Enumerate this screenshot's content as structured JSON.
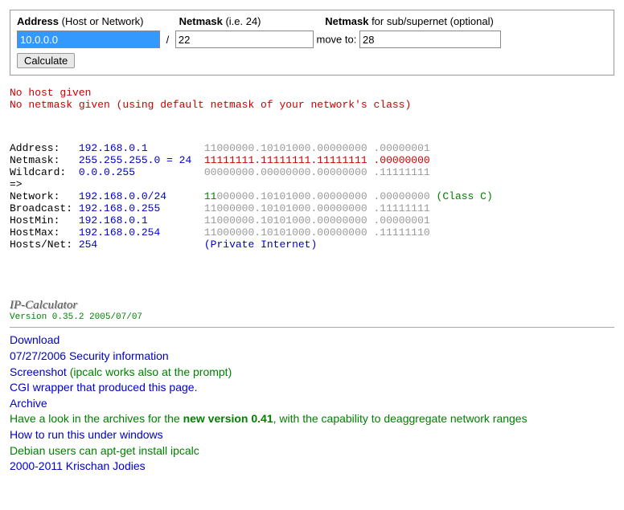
{
  "form": {
    "address_label_bold": "Address",
    "address_label_hint": " (Host or Network)",
    "netmask_label_bold": "Netmask",
    "netmask_label_hint": " (i.e. 24)",
    "netmask2_label_bold": "Netmask",
    "netmask2_label_hint": " for sub/supernet (optional)",
    "move_to_label": "move to: ",
    "address_value": "10.0.0.0",
    "mask_value": "22",
    "move_value": "28",
    "slash": "/",
    "calculate_label": "Calculate"
  },
  "warnings": "No host given\nNo netmask given (using default netmask of your network's class)",
  "rows": {
    "address": {
      "lbl": "Address:   ",
      "val": "192.168.0.1         ",
      "bin_g": "11000000.10101000.00000000 .",
      "bin_c": "00000001",
      "color": "grey"
    },
    "netmask": {
      "lbl": "Netmask:   ",
      "val": "255.255.255.0 = 24  ",
      "bin_r": "11111111.11111111.11111111 .",
      "bin_c": "00000000",
      "color": "red"
    },
    "wildcard": {
      "lbl": "Wildcard:  ",
      "val": "0.0.0.255           ",
      "bin_g": "00000000.00000000.00000000 .",
      "bin_c": "11111111",
      "color": "grey"
    },
    "arrow": "=>",
    "network": {
      "lbl": "Network:   ",
      "val": "192.168.0.0/24      ",
      "bin_b": "11",
      "bin_g": "000000.10101000.00000000 .",
      "bin_c": "00000000",
      "suffix": " (Class C)"
    },
    "broadcast": {
      "lbl": "Broadcast: ",
      "val": "192.168.0.255       ",
      "bin_g": "11000000.10101000.00000000 .",
      "bin_c": "11111111",
      "color": "grey"
    },
    "hostmin": {
      "lbl": "HostMin:   ",
      "val": "192.168.0.1         ",
      "bin_g": "11000000.10101000.00000000 .",
      "bin_c": "00000001",
      "color": "grey"
    },
    "hostmax": {
      "lbl": "HostMax:   ",
      "val": "192.168.0.254       ",
      "bin_g": "11000000.10101000.00000000 .",
      "bin_c": "11111110",
      "color": "grey"
    },
    "hostsnet": {
      "lbl": "Hosts/Net: ",
      "val": "254                 ",
      "note": "(Private Internet)"
    }
  },
  "footer": {
    "logo": "IP-Calculator",
    "version": "Version 0.35.2 2005/07/07",
    "download": "Download",
    "security": "07/27/2006 Security information",
    "screenshot_link": "Screenshot",
    "screenshot_aside": " (ipcalc works also at the prompt)",
    "cgi": "CGI wrapper that produced this page.",
    "archive": "Archive",
    "archive_prefix": "Have a look in the archives for the ",
    "archive_bold": "new version 0.41",
    "archive_suffix": ", with the capability to deaggregate network ranges",
    "windows": "How to run this under windows",
    "debian": "Debian users can apt-get install ipcalc",
    "copyright": "2000-2011 Krischan Jodies"
  }
}
